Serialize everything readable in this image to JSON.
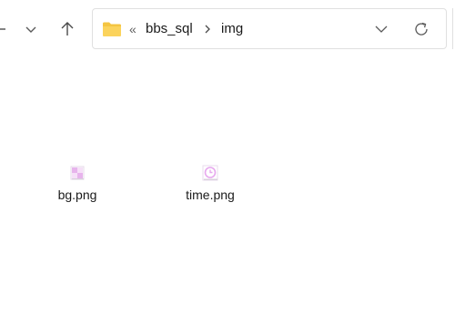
{
  "navigation": {
    "back_icon": "back-arrow-icon",
    "history_icon": "chevron-down-icon",
    "up_icon": "up-arrow-icon"
  },
  "address_bar": {
    "folder_icon": "folder-icon",
    "overflow_label": "«",
    "breadcrumbs": [
      {
        "label": "bbs_sql"
      },
      {
        "label": "img"
      }
    ],
    "dropdown_icon": "chevron-down-icon",
    "refresh_icon": "refresh-icon"
  },
  "files": [
    {
      "name": "bg.png",
      "icon": "png-image-icon"
    },
    {
      "name": "time.png",
      "icon": "png-clock-image-icon"
    }
  ],
  "colors": {
    "folder": "#f4c542",
    "thumb_pink": "#e7b4ec",
    "thumb_light": "#f6e0f8"
  }
}
